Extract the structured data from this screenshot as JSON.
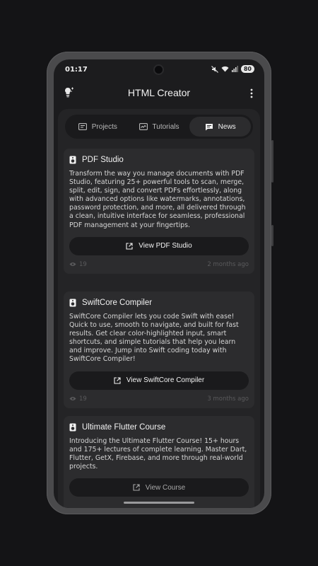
{
  "status": {
    "time": "01:17",
    "battery": "80"
  },
  "appbar": {
    "title": "HTML Creator",
    "left_icon": "lightbulb-icon",
    "menu_icon": "more-vert-icon"
  },
  "tabs": [
    {
      "label": "Projects",
      "icon": "projects-icon",
      "active": false
    },
    {
      "label": "Tutorials",
      "icon": "tutorials-icon",
      "active": false
    },
    {
      "label": "News",
      "icon": "news-icon",
      "active": true
    }
  ],
  "news": [
    {
      "title": "PDF Studio",
      "description": "Transform the way you manage documents with PDF Studio, featuring 25+ powerful tools to scan, merge, split, edit, sign, and convert PDFs effortlessly, along with advanced options like watermarks, annotations, password protection, and more, all delivered through a clean, intuitive interface for seamless, professional PDF management at your fingertips.",
      "button": "View PDF Studio",
      "views": "19",
      "time": "2 months ago"
    },
    {
      "title": "SwiftCore Compiler",
      "description": "SwiftCore Compiler lets you code Swift with ease! Quick to use, smooth to navigate, and built for fast results. Get clear color-highlighted input, smart shortcuts, and simple tutorials that help you learn and improve. Jump into Swift coding today with SwiftCore Compiler!",
      "button": "View SwiftCore Compiler",
      "views": "19",
      "time": "3 months ago"
    },
    {
      "title": "Ultimate Flutter Course",
      "description": "Introducing the Ultimate Flutter Course! 15+ hours and 175+ lectures of complete learning. Master Dart, Flutter, GetX, Firebase, and more through real-world projects.",
      "button": "View Course"
    }
  ],
  "colors": {
    "background": "#141416",
    "screen": "#1c1c1e",
    "card": "#2c2c2e",
    "text": "#f2f2f2"
  }
}
